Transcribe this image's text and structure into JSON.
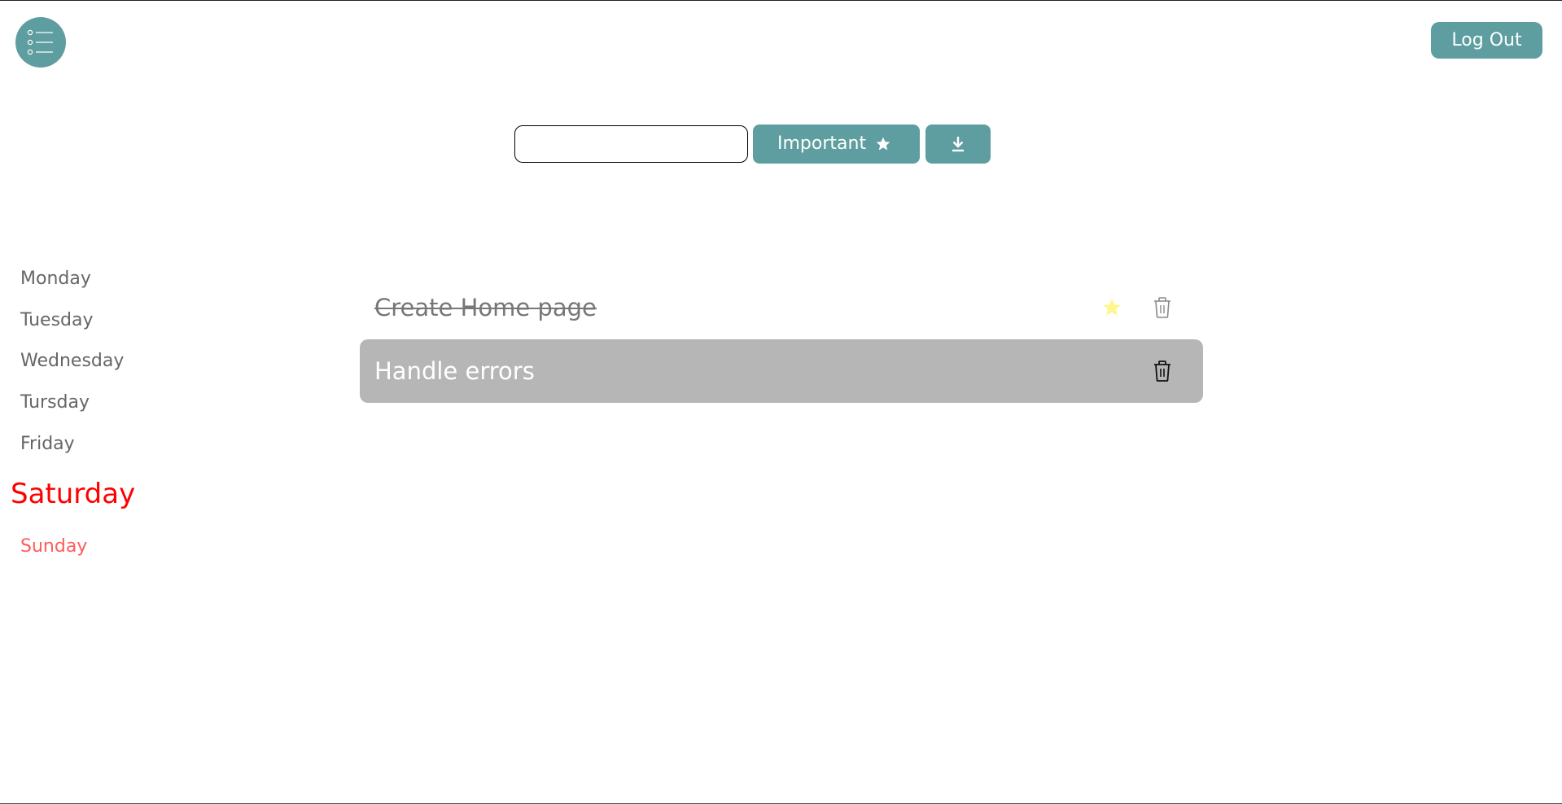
{
  "header": {
    "menu_icon": "list-icon",
    "logout_label": "Log Out"
  },
  "toolbar": {
    "input_value": "",
    "input_placeholder": "",
    "important_label": "Important",
    "important_icon": "star-icon",
    "download_icon": "download-icon"
  },
  "days": [
    {
      "label": "Monday",
      "active": false
    },
    {
      "label": "Tuesday",
      "active": false
    },
    {
      "label": "Wednesday",
      "active": false
    },
    {
      "label": "Tursday",
      "active": false
    },
    {
      "label": "Friday",
      "active": false
    },
    {
      "label": "Saturday",
      "active": true
    },
    {
      "label": "Sunday",
      "active": false
    }
  ],
  "tasks": [
    {
      "text": "Create Home page",
      "done": true,
      "important": true,
      "selected": false
    },
    {
      "text": "Handle errors",
      "done": false,
      "important": false,
      "selected": true
    }
  ],
  "colors": {
    "accent": "#5f9ea0",
    "active_day": "#ff0000",
    "sunday": "#ff5c5c",
    "star": "#fff68f",
    "selected_task_bg": "#b6b6b6"
  }
}
